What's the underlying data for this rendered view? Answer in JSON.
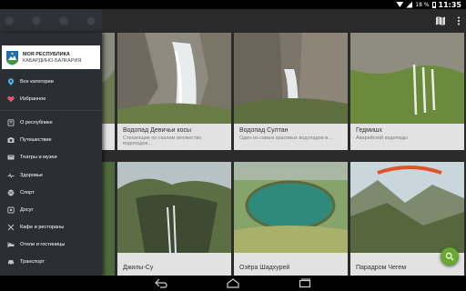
{
  "status_bar": {
    "battery_pct": "18 %",
    "time": "11:35"
  },
  "app_bar": {
    "map_icon": "map-icon",
    "more_icon": "more-vert-icon"
  },
  "drawer": {
    "header": {
      "title": "МОЯ РЕСПУБЛИКА",
      "subtitle": "КАБАРДИНО-БАЛКАРИЯ"
    },
    "primary_items": [
      {
        "label": "Все категории",
        "icon": "location-pin-icon",
        "color": "#4fb3e8"
      },
      {
        "label": "Избранное",
        "icon": "heart-icon",
        "color": "#e25b6a"
      }
    ],
    "items": [
      {
        "label": "О республике",
        "icon": "book-icon"
      },
      {
        "label": "Путешествие",
        "icon": "camera-icon"
      },
      {
        "label": "Театры и музеи",
        "icon": "theater-icon"
      },
      {
        "label": "Здоровье",
        "icon": "health-icon"
      },
      {
        "label": "Спорт",
        "icon": "ball-icon"
      },
      {
        "label": "Досуг",
        "icon": "leisure-icon"
      },
      {
        "label": "Кафе и рестораны",
        "icon": "cutlery-icon"
      },
      {
        "label": "Отели и гостиницы",
        "icon": "bed-icon"
      },
      {
        "label": "Транспорт",
        "icon": "car-icon"
      }
    ]
  },
  "cards": [
    {
      "title": "Водопад Девичьи косы",
      "subtitle": "Стекающие по скалам множество водопадов..."
    },
    {
      "title": "Водопад Султан",
      "subtitle": "Один из самых красивых водопадов в..."
    },
    {
      "title": "Гедмишх",
      "subtitle": "Аварийский водопады"
    },
    {
      "title": "Джилы-Су",
      "subtitle": ""
    },
    {
      "title": "Озёра Шадхурей",
      "subtitle": ""
    },
    {
      "title": "Парадром Чегем",
      "subtitle": ""
    }
  ],
  "colors": {
    "accent": "#6aa832",
    "drawer_bg": "#2b2f34",
    "appbar_bg": "#2a2a2a"
  }
}
